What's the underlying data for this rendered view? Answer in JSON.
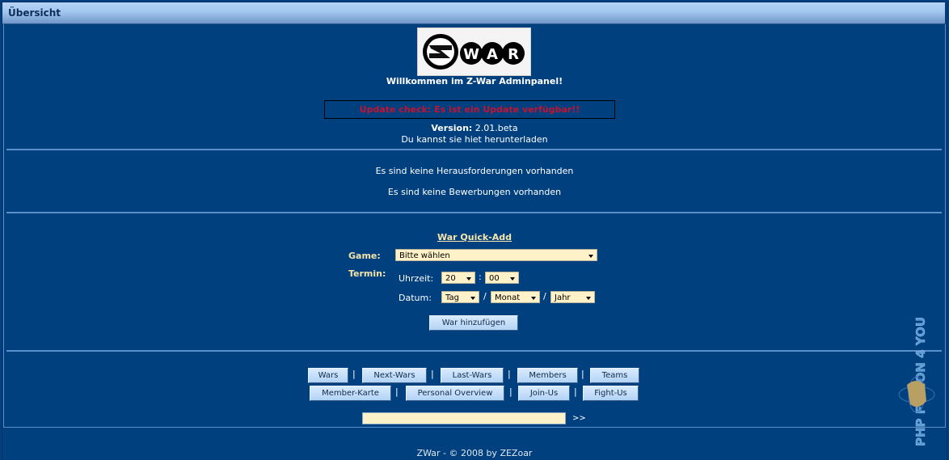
{
  "window": {
    "title": "Übersicht"
  },
  "header": {
    "logo_text": "WAR",
    "welcome": "Willkommen im Z-War Adminpanel!",
    "update_notice": "Update check: Es ist ein Update verfügbar!!",
    "version_label": "Version:",
    "version_value": "2.01.beta",
    "download_text": "Du kannst sie hiet herunterladen"
  },
  "messages": {
    "challenges": "Es sind keine Herausforderungen vorhanden",
    "applications": "Es sind keine Bewerbungen vorhanden"
  },
  "quick_add": {
    "title": "War Quick-Add",
    "game_label": "Game:",
    "game_value": "Bitte wählen",
    "termin_label": "Termin:",
    "time_label": "Uhrzeit:",
    "hour_value": "20",
    "time_separator": ":",
    "minute_value": "00",
    "date_label": "Datum:",
    "day_value": "Tag",
    "month_value": "Monat",
    "year_value": "Jahr",
    "date_separator": "/",
    "submit_label": "War hinzufügen"
  },
  "nav": {
    "row1": [
      "Wars",
      "Next-Wars",
      "Last-Wars",
      "Members",
      "Teams"
    ],
    "row2": [
      "Member-Karte",
      "Personal Overview",
      "Join-Us",
      "Fight-Us"
    ],
    "separator": "|"
  },
  "jump": {
    "input_value": "",
    "go_label": ">>"
  },
  "footer": {
    "text": "ZWar - © 2008 by ZEZoar"
  },
  "watermark": {
    "text": "PHP FUSION 4 YOU"
  },
  "colors": {
    "background": "#01407f",
    "update_text": "#c41230",
    "label_text": "#f3e3a8",
    "input_bg": "#fff1c8"
  }
}
